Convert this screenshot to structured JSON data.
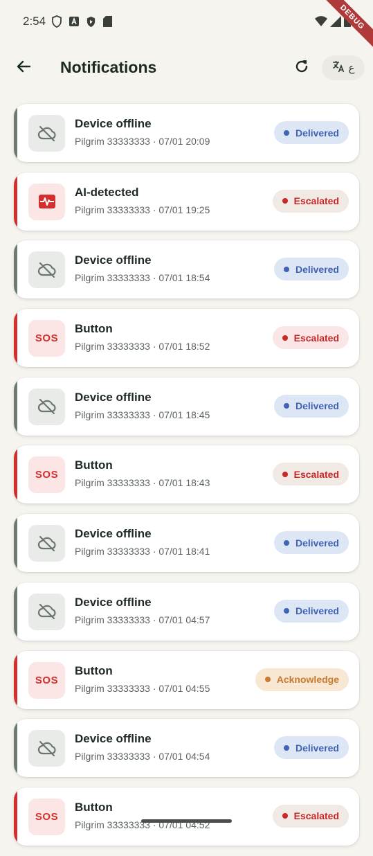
{
  "status_bar": {
    "time": "2:54",
    "debug_label": "DEBUG"
  },
  "app_bar": {
    "title": "Notifications",
    "lang_label": "ع"
  },
  "colors": {
    "delivered_accent": "#6b7a72",
    "escalated_accent": "#d32f2f",
    "delivered_badge_bg": "#dde6f5",
    "delivered_badge_fg": "#3f63b2",
    "escalated_badge_bg": "#f1e9e3",
    "escalated_badge_bg_alt": "#fae6e6",
    "escalated_badge_fg": "#c62828",
    "ack_badge_bg": "#f8e7d2",
    "ack_badge_fg": "#c97a2e"
  },
  "notifications": [
    {
      "type": "offline",
      "title": "Device offline",
      "subtitle": "Pilgrim 33333333 · 07/01 20:09",
      "status": "delivered",
      "badge": "Delivered"
    },
    {
      "type": "ai",
      "title": "AI-detected",
      "subtitle": "Pilgrim 33333333 · 07/01 19:25",
      "status": "escalated",
      "badge": "Escalated"
    },
    {
      "type": "offline",
      "title": "Device offline",
      "subtitle": "Pilgrim 33333333 · 07/01 18:54",
      "status": "delivered",
      "badge": "Delivered"
    },
    {
      "type": "sos",
      "title": "Button",
      "subtitle": "Pilgrim 33333333 · 07/01 18:52",
      "status": "escalated-alt",
      "badge": "Escalated",
      "icon_text": "SOS"
    },
    {
      "type": "offline",
      "title": "Device offline",
      "subtitle": "Pilgrim 33333333 · 07/01 18:45",
      "status": "delivered",
      "badge": "Delivered"
    },
    {
      "type": "sos",
      "title": "Button",
      "subtitle": "Pilgrim 33333333 · 07/01 18:43",
      "status": "escalated",
      "badge": "Escalated",
      "icon_text": "SOS"
    },
    {
      "type": "offline",
      "title": "Device offline",
      "subtitle": "Pilgrim 33333333 · 07/01 18:41",
      "status": "delivered",
      "badge": "Delivered"
    },
    {
      "type": "offline",
      "title": "Device offline",
      "subtitle": "Pilgrim 33333333 · 07/01 04:57",
      "status": "delivered",
      "badge": "Delivered"
    },
    {
      "type": "sos",
      "title": "Button",
      "subtitle": "Pilgrim 33333333 · 07/01 04:55",
      "status": "ack",
      "badge": "Acknowledge",
      "icon_text": "SOS"
    },
    {
      "type": "offline",
      "title": "Device offline",
      "subtitle": "Pilgrim 33333333 · 07/01 04:54",
      "status": "delivered",
      "badge": "Delivered"
    },
    {
      "type": "sos",
      "title": "Button",
      "subtitle": "Pilgrim 33333333 · 07/01 04:52",
      "status": "escalated",
      "badge": "Escalated",
      "icon_text": "SOS"
    }
  ]
}
